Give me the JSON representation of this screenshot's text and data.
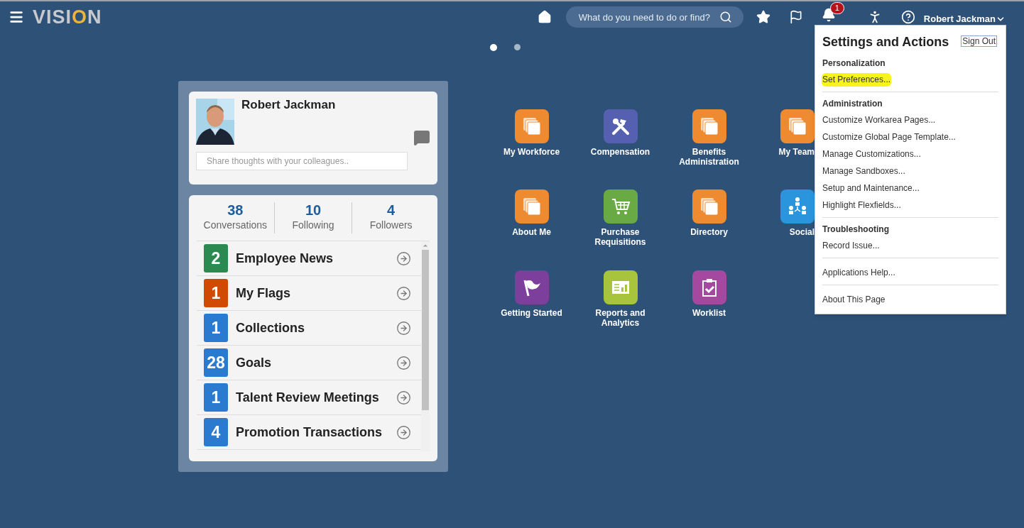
{
  "header": {
    "logo": "VISION",
    "search": {
      "placeholder": "What do you need to do or find?"
    },
    "notification_count": "1",
    "user_name": "Robert Jackman"
  },
  "page_dots": [
    {
      "selected": true
    },
    {
      "selected": false
    }
  ],
  "profile": {
    "name": "Robert Jackman",
    "share": {
      "placeholder": "Share thoughts with your colleagues.."
    }
  },
  "stats": [
    {
      "value": "38",
      "label": "Conversations"
    },
    {
      "value": "10",
      "label": "Following"
    },
    {
      "value": "4",
      "label": "Followers"
    }
  ],
  "feed": [
    {
      "count": "2",
      "label": "Employee News",
      "color": "#2a8a4f"
    },
    {
      "count": "1",
      "label": "My Flags",
      "color": "#d04a02"
    },
    {
      "count": "1",
      "label": "Collections",
      "color": "#2a7ad0"
    },
    {
      "count": "28",
      "label": "Goals",
      "color": "#2a7ad0"
    },
    {
      "count": "1",
      "label": "Talent Review Meetings",
      "color": "#2a7ad0"
    },
    {
      "count": "4",
      "label": "Promotion Transactions",
      "color": "#2a7ad0"
    }
  ],
  "tiles": [
    {
      "label": "My Workforce",
      "kind": "stack",
      "color": "#ee8a2f"
    },
    {
      "label": "Compensation",
      "kind": "tools",
      "color": "#5560b0"
    },
    {
      "label": "Benefits Administration",
      "kind": "stack",
      "color": "#ee8a2f"
    },
    {
      "label": "My Team",
      "kind": "stack",
      "color": "#ee8a2f"
    },
    {
      "label": "About Me",
      "kind": "stack",
      "color": "#ee8a2f"
    },
    {
      "label": "Purchase Requisitions",
      "kind": "cart",
      "color": "#6aaa44"
    },
    {
      "label": "Directory",
      "kind": "stack",
      "color": "#ee8a2f"
    },
    {
      "label": "Social",
      "kind": "people",
      "color": "#2a95dc"
    },
    {
      "label": "Getting Started",
      "kind": "flag",
      "color": "#7d3f9c"
    },
    {
      "label": "Reports and Analytics",
      "kind": "report",
      "color": "#a7c43c"
    },
    {
      "label": "Worklist",
      "kind": "clipboard",
      "color": "#a548a0"
    }
  ],
  "menu": {
    "title": "Settings and Actions",
    "sign_out": "Sign Out",
    "sections": [
      {
        "heading": "Personalization",
        "items": [
          {
            "label": "Set Preferences...",
            "highlighted": true
          }
        ]
      },
      {
        "heading": "Administration",
        "items": [
          {
            "label": "Customize Workarea Pages...",
            "highlighted": false
          },
          {
            "label": "Customize Global Page Template...",
            "highlighted": false
          },
          {
            "label": "Manage Customizations...",
            "highlighted": false
          },
          {
            "label": "Manage Sandboxes...",
            "highlighted": false
          },
          {
            "label": "Setup and Maintenance...",
            "highlighted": false
          },
          {
            "label": "Highlight Flexfields...",
            "highlighted": false
          }
        ]
      },
      {
        "heading": "Troubleshooting",
        "items": [
          {
            "label": "Record Issue...",
            "highlighted": false
          }
        ]
      },
      {
        "items": [
          {
            "label": "Applications Help...",
            "highlighted": false
          }
        ]
      },
      {
        "items": [
          {
            "label": "About This Page",
            "highlighted": false
          }
        ]
      }
    ]
  }
}
